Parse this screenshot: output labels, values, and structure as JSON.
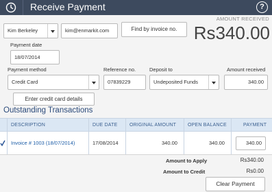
{
  "header": {
    "title": "Receive Payment",
    "help": "?"
  },
  "amount_received_label": "AMOUNT RECEIVED",
  "amount_received_big": "Rs340.00",
  "customer": {
    "name": "Kim Berkeley",
    "email": "kim@enmarkit.com"
  },
  "find_by_invoice": "Find by invoice no.",
  "payment_date": {
    "label": "Payment date",
    "value": "18/07/2014"
  },
  "payment_method": {
    "label": "Payment method",
    "value": "Credit Card"
  },
  "reference": {
    "label": "Reference no.",
    "value": "07839229"
  },
  "deposit_to": {
    "label": "Deposit to",
    "value": "Undeposited Funds"
  },
  "amount_received": {
    "label": "Amount received",
    "value": "340.00"
  },
  "credit_card_button": "Enter credit card details",
  "outstanding_title": "Outstanding Transactions",
  "table": {
    "headers": [
      "DESCRIPTION",
      "DUE DATE",
      "ORIGINAL AMOUNT",
      "OPEN BALANCE",
      "PAYMENT"
    ],
    "rows": [
      {
        "description": "Invoice # 1003 (18/07/2014)",
        "due_date": "17/08/2014",
        "original_amount": "340.00",
        "open_balance": "340.00",
        "payment": "340.00"
      }
    ]
  },
  "summary": {
    "apply_label": "Amount to Apply",
    "apply_value": "Rs340.00",
    "credit_label": "Amount to Credit",
    "credit_value": "Rs0.00"
  },
  "clear_payment": "Clear Payment"
}
